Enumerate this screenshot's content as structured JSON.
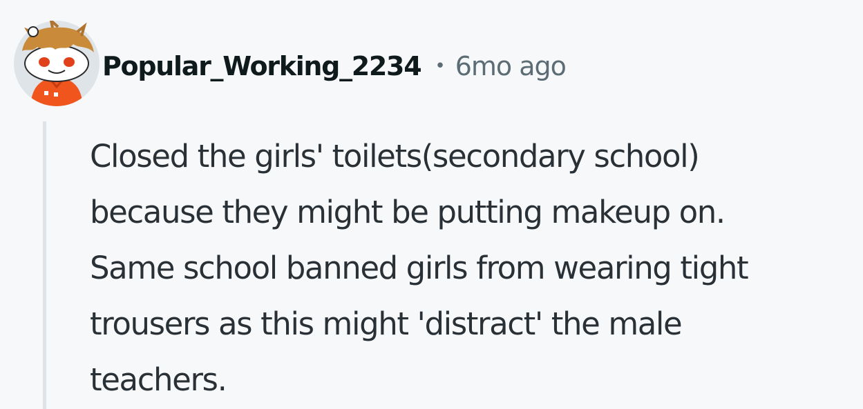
{
  "comment": {
    "author": "Popular_Working_2234",
    "separator": "•",
    "time": "6mo ago",
    "body_lines": [
      "Closed the girls' toilets(secondary school)",
      "because they might be putting makeup on.",
      "Same school banned girls from wearing tight",
      "trousers as this might 'distract' the male",
      "teachers."
    ]
  },
  "avatar": {
    "icon": "snoo-avatar-icon",
    "colors": {
      "hair": "#c98a3a",
      "shirt": "#f0551e",
      "eyes": "#e0401a",
      "face": "#ffffff",
      "background": "#dfe4e8"
    }
  },
  "colors": {
    "background": "#f7f8fa",
    "username": "#0f1a1c",
    "meta": "#5c6c74",
    "body": "#2a3136",
    "thread_line": "#dde3e7"
  }
}
